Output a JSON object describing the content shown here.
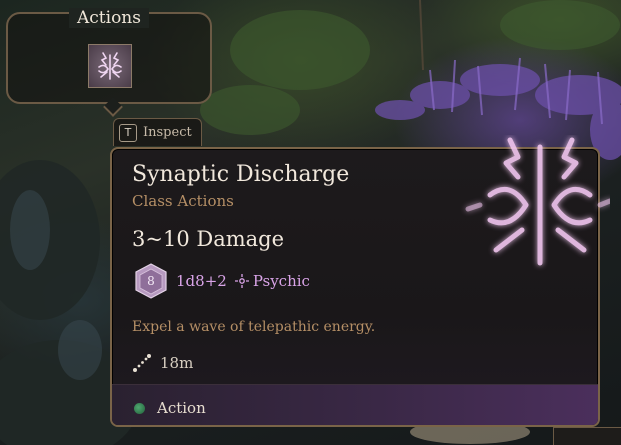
{
  "actions_panel": {
    "title": "Actions",
    "slot_icon": "synaptic-discharge-icon"
  },
  "inspect_hint": {
    "key": "T",
    "label": "Inspect"
  },
  "tooltip": {
    "spell_name": "Synaptic Discharge",
    "category": "Class Actions",
    "damage": "3~10 Damage",
    "dice_icon": "d8-dice-icon",
    "dice_face": "8",
    "dice_value": "1d8+2",
    "damage_type_icon": "psychic-icon",
    "damage_type": "Psychic",
    "description": "Expel a wave of telepathic energy.",
    "range_icon": "range-icon",
    "range": "18m",
    "cost_label": "Action",
    "cost_color": "#3f9a5e",
    "accent_color": "#d9a4e8"
  }
}
